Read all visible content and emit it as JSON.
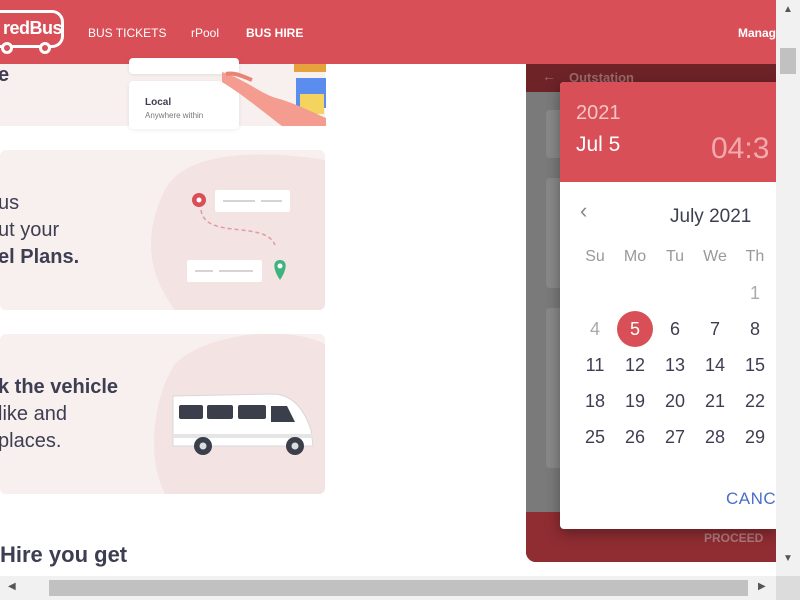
{
  "header": {
    "logo_text": "redBus",
    "nav": [
      "BUS TICKETS",
      "rPool",
      "BUS HIRE"
    ],
    "manage_label": "Manag"
  },
  "top_card": {
    "partial_char": "e",
    "local_title": "Local",
    "local_sub": "Anywhere within"
  },
  "card1": {
    "line1": "us",
    "line2": "ut your",
    "line3_bold": "el Plans."
  },
  "card2": {
    "line1_bold": "k the vehicle",
    "line2": "like and",
    "line3": "places."
  },
  "section_heading": "Hire you get",
  "panel": {
    "back_icon": "←",
    "title": "Outstation",
    "proceed": "PROCEED"
  },
  "picker": {
    "year": "2021",
    "date": "Jul 5",
    "time": "04:3",
    "month_label": "July 2021",
    "prev_icon": "‹",
    "weekdays": [
      "Su",
      "Mo",
      "Tu",
      "We",
      "Th"
    ],
    "days": {
      "r0c4": "1",
      "r1c0": "4",
      "r1c1": "5",
      "r1c2": "6",
      "r1c3": "7",
      "r1c4": "8",
      "r2c0": "11",
      "r2c1": "12",
      "r2c2": "13",
      "r2c3": "14",
      "r2c4": "15",
      "r3c0": "18",
      "r3c1": "19",
      "r3c2": "20",
      "r3c3": "21",
      "r3c4": "22",
      "r4c0": "25",
      "r4c1": "26",
      "r4c2": "27",
      "r4c3": "28",
      "r4c4": "29"
    },
    "selected_day": "5",
    "cancel_label": "CANC"
  },
  "colors": {
    "brand": "#d84f57",
    "card_bg": "#f8efef",
    "cancel_blue": "#4a6fc7"
  }
}
